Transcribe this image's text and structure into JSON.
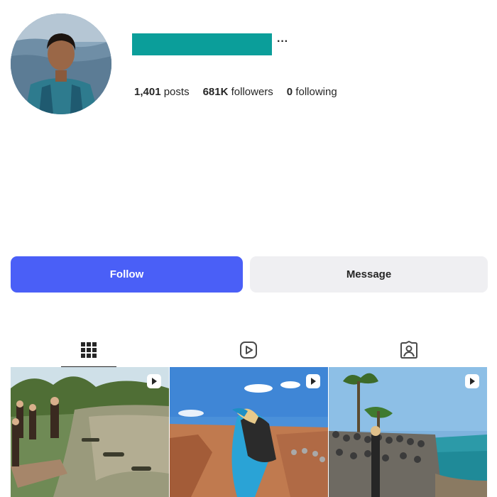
{
  "profile": {
    "avatar_icon": "profile-photo",
    "username_redacted": true,
    "more_options_label": "···"
  },
  "stats": {
    "posts": {
      "count": "1,401",
      "label": "posts"
    },
    "followers": {
      "count": "681K",
      "label": "followers"
    },
    "following": {
      "count": "0",
      "label": "following"
    }
  },
  "actions": {
    "follow_label": "Follow",
    "message_label": "Message"
  },
  "tabs": [
    {
      "name": "posts",
      "icon": "grid-icon",
      "active": true
    },
    {
      "name": "reels",
      "icon": "reels-icon",
      "active": false
    },
    {
      "name": "tagged",
      "icon": "tagged-icon",
      "active": false
    }
  ],
  "grid": [
    {
      "type": "reel",
      "icon": "reel-badge-icon"
    },
    {
      "type": "reel",
      "icon": "reel-badge-icon"
    },
    {
      "type": "reel",
      "icon": "reel-badge-icon"
    }
  ],
  "colors": {
    "follow_button": "#4a5ff7",
    "message_button": "#efeff2",
    "username_redaction": "#0b9e9a"
  }
}
